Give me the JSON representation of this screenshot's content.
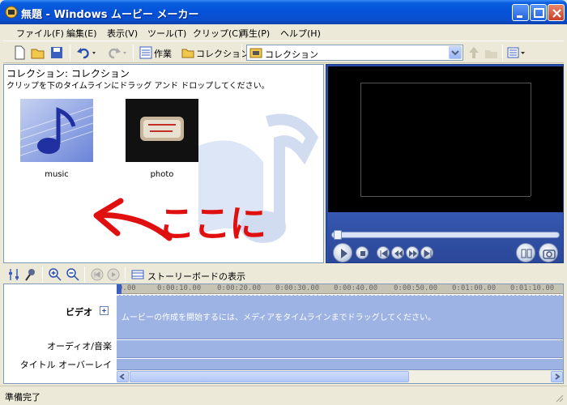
{
  "window": {
    "title": "無題 - Windows ムービー メーカー"
  },
  "menu": [
    "ファイル(F)",
    "編集(E)",
    "表示(V)",
    "ツール(T)",
    "クリップ(C)",
    "再生(P)",
    "ヘルプ(H)"
  ],
  "toolbar": {
    "tasks_label": "作業",
    "collections_label": "コレクション",
    "collection_combo_value": "コレクション"
  },
  "collection": {
    "title": "コレクション: コレクション",
    "hint": "クリップを下のタイムラインにドラッグ アンド ドロップしてください。",
    "items": [
      {
        "label": "music"
      },
      {
        "label": "photo"
      }
    ],
    "annotation_text": "ここに"
  },
  "timeline": {
    "storyboard_label": "ストーリーボードの表示",
    "ruler_ticks": [
      "0.00",
      "0:00:10.00",
      "0:00:20.00",
      "0:00:30.00",
      "0:00:40.00",
      "0:00:50.00",
      "0:01:00.00",
      "0:01:10.00"
    ],
    "tracks": {
      "video": "ビデオ",
      "audio": "オーディオ/音楽",
      "title": "タイトル オーバーレイ"
    },
    "video_hint": "ムービーの作成を開始するには、メディアをタイムラインまでドラッグしてください。"
  },
  "status": {
    "text": "準備完了"
  },
  "colors": {
    "titlebar": "#0553d8",
    "monitor_bg": "#2a4ea8",
    "track": "#9db3e4",
    "annotation_red": "#e01010"
  }
}
